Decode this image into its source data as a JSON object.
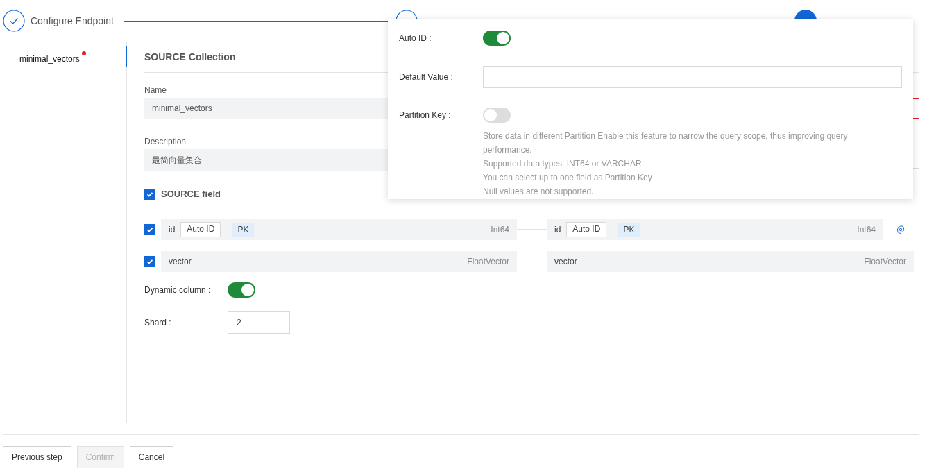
{
  "steps": [
    {
      "label": "Configure Endpoint",
      "completed": true,
      "active": false
    },
    {
      "active": false
    },
    {
      "active": true
    }
  ],
  "sidebar": {
    "items": [
      {
        "label": "minimal_vectors",
        "selected": true,
        "error": true
      }
    ]
  },
  "source": {
    "title": "SOURCE Collection",
    "name_label": "Name",
    "name_value": "minimal_vectors",
    "description_label": "Description",
    "description_value": "最简向量集合",
    "fields_label": "SOURCE field",
    "fields_checked": true
  },
  "target": {
    "name_error": true
  },
  "fields": [
    {
      "checked": true,
      "name": "id",
      "tags": [
        {
          "label": "Auto ID",
          "kind": "outline"
        },
        {
          "label": "PK",
          "kind": "fill"
        }
      ],
      "type": "Int64",
      "target_name": "id",
      "target_tags": [
        {
          "label": "Auto ID",
          "kind": "outline"
        },
        {
          "label": "PK",
          "kind": "fill"
        }
      ],
      "target_type": "Int64",
      "settings": true
    },
    {
      "checked": true,
      "name": "vector",
      "type": "FloatVector",
      "target_name": "vector",
      "target_type": "FloatVector",
      "settings": false
    }
  ],
  "dynamic_column": {
    "label": "Dynamic column :",
    "on": true
  },
  "shard": {
    "label": "Shard :",
    "value": "2"
  },
  "popover": {
    "auto_id": {
      "label": "Auto ID :",
      "on": true
    },
    "default_value": {
      "label": "Default Value :"
    },
    "partition_key": {
      "label": "Partition Key :",
      "on": false,
      "help": [
        "Store data in different Partition Enable this feature to narrow the query scope, thus improving query performance.",
        "Supported data types: INT64 or VARCHAR",
        "You can select up to one field as Partition Key",
        "Null values are not supported."
      ]
    }
  },
  "buttons": [
    {
      "label": "Previous step",
      "disabled": false
    },
    {
      "label": "Confirm",
      "disabled": true
    },
    {
      "label": "Cancel",
      "disabled": false
    }
  ]
}
